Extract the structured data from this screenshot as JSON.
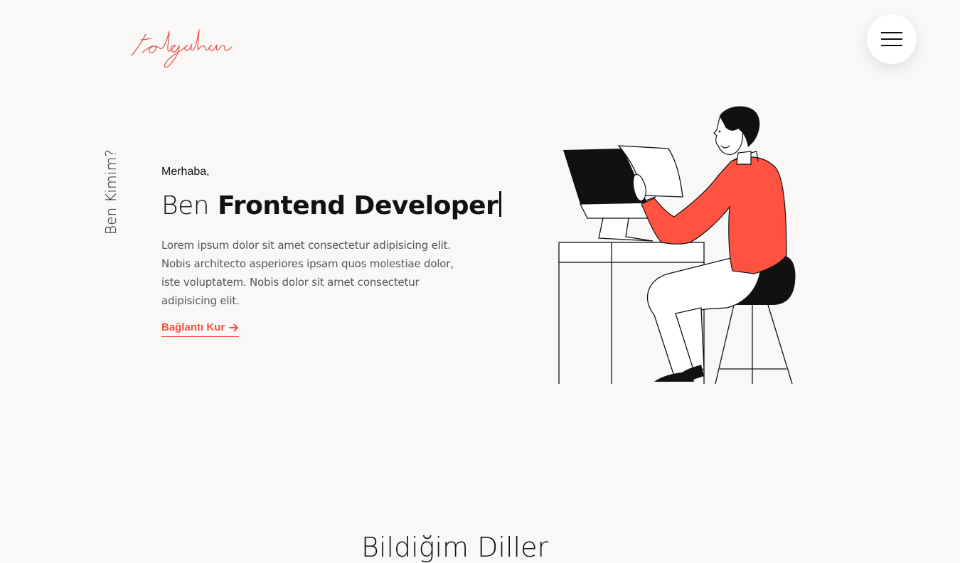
{
  "header": {
    "logo_text": "tolgahan",
    "menu_icon": "hamburger-icon"
  },
  "hero": {
    "side_label": "Ben Kimim?",
    "greeting": "Merhaba,",
    "headline_prefix": "Ben",
    "headline_role": "Frontend Developer",
    "description": "Lorem ipsum dolor sit amet consectetur adipisicing elit. Nobis architecto asperiores ipsam quos molestiae dolor, iste voluptatem. Nobis dolor sit amet consectetur adipisicing elit.",
    "cta_label": "Bağlantı Kur",
    "cta_icon": "arrow-right-icon"
  },
  "next_section": {
    "title_partial": "Bildiğim Diller"
  },
  "colors": {
    "accent": "#ff4e3f",
    "background": "#f9f8f6",
    "text": "#111111",
    "muted_text": "#555555"
  }
}
